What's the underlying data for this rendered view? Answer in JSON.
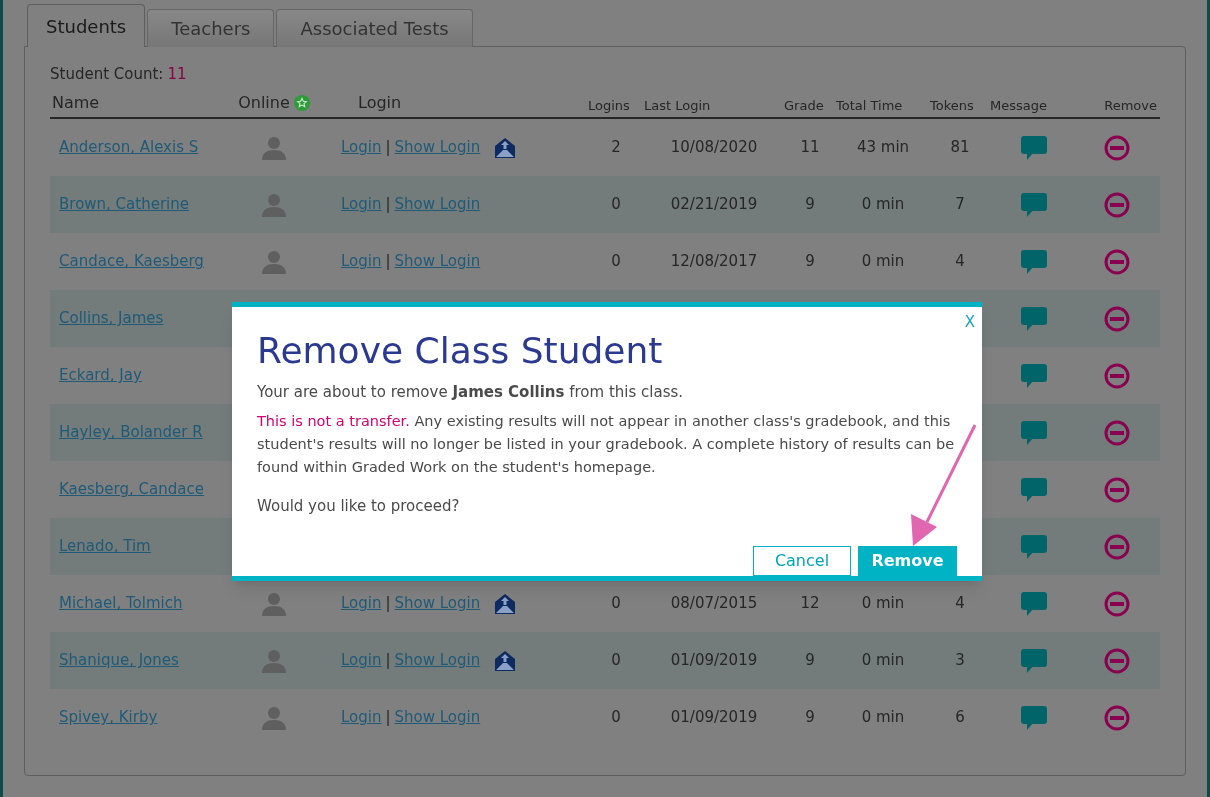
{
  "tabs": [
    {
      "label": "Students",
      "selected": true
    },
    {
      "label": "Teachers",
      "selected": false
    },
    {
      "label": "Associated Tests",
      "selected": false
    }
  ],
  "student_count": {
    "label": "Student Count:",
    "value": "11"
  },
  "table": {
    "columns": [
      "Name",
      "Online",
      "Login",
      "Logins",
      "Last Login",
      "Grade",
      "Total Time",
      "Tokens",
      "Message",
      "Remove"
    ],
    "rows": [
      {
        "name": "Anderson, Alexis S",
        "login": "Login",
        "separator": "|",
        "show_login": "Show Login",
        "email_sent": true,
        "logins": "2",
        "last_login": "10/08/2020",
        "grade": "11",
        "total_time": "43 min",
        "tokens": "81"
      },
      {
        "name": "Brown, Catherine",
        "login": "Login",
        "separator": "|",
        "show_login": "Show Login",
        "email_sent": false,
        "logins": "0",
        "last_login": "02/21/2019",
        "grade": "9",
        "total_time": "0 min",
        "tokens": "7"
      },
      {
        "name": "Candace, Kaesberg",
        "login": "Login",
        "separator": "|",
        "show_login": "Show Login",
        "email_sent": false,
        "logins": "0",
        "last_login": "12/08/2017",
        "grade": "9",
        "total_time": "0 min",
        "tokens": "4"
      },
      {
        "name": "Collins, James"
      },
      {
        "name": "Eckard, Jay"
      },
      {
        "name": "Hayley, Bolander R"
      },
      {
        "name": "Kaesberg, Candace"
      },
      {
        "name": "Lenado, Tim"
      },
      {
        "name": "Michael, Tolmich",
        "login": "Login",
        "separator": "|",
        "show_login": "Show Login",
        "email_sent": true,
        "logins": "0",
        "last_login": "08/07/2015",
        "grade": "12",
        "total_time": "0 min",
        "tokens": "4"
      },
      {
        "name": "Shanique, Jones",
        "login": "Login",
        "separator": "|",
        "show_login": "Show Login",
        "email_sent": true,
        "logins": "0",
        "last_login": "01/09/2019",
        "grade": "9",
        "total_time": "0 min",
        "tokens": "3"
      },
      {
        "name": "Spivey, Kirby",
        "login": "Login",
        "separator": "|",
        "show_login": "Show Login",
        "email_sent": false,
        "logins": "0",
        "last_login": "01/09/2019",
        "grade": "9",
        "total_time": "0 min",
        "tokens": "6"
      }
    ]
  },
  "dialog": {
    "title": "Remove Class Student",
    "close": "X",
    "message": "Your are about to remove **James Collins** from this class.",
    "warning_highlight": "This is not a transfer.",
    "warning": "Any existing results will not appear in another class's gradebook, and this student's results will no longer be listed in your gradebook. A complete history of results can be found within Graded Work on the student's homepage.",
    "question": "Would you like to proceed?",
    "buttons": [
      {
        "label": "Cancel",
        "kind": "secondary"
      },
      {
        "label": "Remove",
        "kind": "primary"
      }
    ]
  }
}
